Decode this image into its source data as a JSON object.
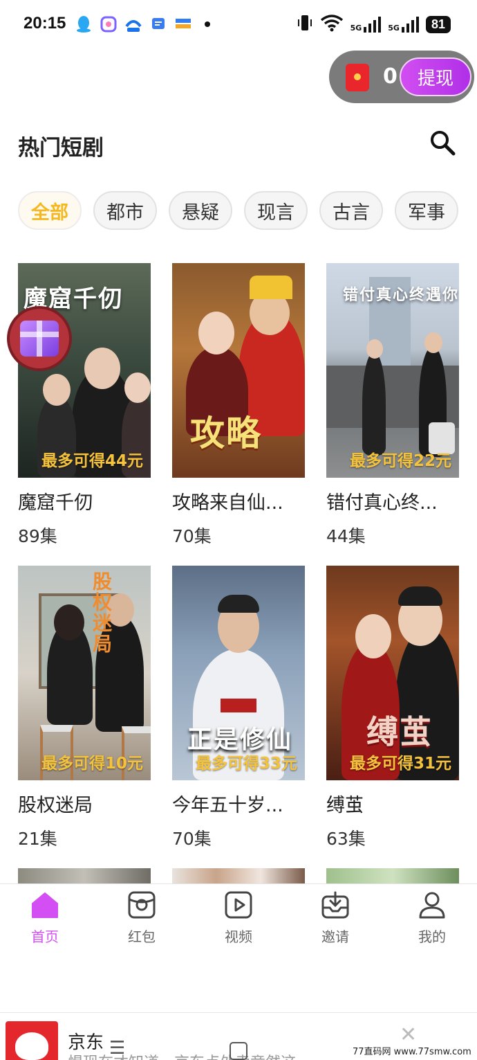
{
  "status_bar": {
    "time": "20:15",
    "battery": "81",
    "signal_label": "5G",
    "icons": [
      "qq-icon",
      "app-icon",
      "fly-app-icon",
      "message-icon",
      "wallet-icon",
      "vibrate-icon",
      "wifi-icon",
      "signal-icon",
      "signal-icon"
    ]
  },
  "reward": {
    "count": "0",
    "withdraw_label": "提现"
  },
  "header": {
    "title": "热门短剧"
  },
  "categories": [
    "全部",
    "都市",
    "悬疑",
    "现言",
    "古言",
    "军事"
  ],
  "active_category": "全部",
  "dramas": [
    {
      "title": "魔窟千仞",
      "episodes": "89集",
      "poster_caption": "魔窟千仞",
      "reward_tag": "最多可得44元"
    },
    {
      "title": "攻略来自仙...",
      "episodes": "70集",
      "poster_caption": "攻略",
      "reward_tag": ""
    },
    {
      "title": "错付真心终...",
      "episodes": "44集",
      "poster_caption": "错付真心终遇你",
      "reward_tag": "最多可得22元"
    },
    {
      "title": "股权迷局",
      "episodes": "21集",
      "poster_caption": "股权迷局",
      "reward_tag": "最多可得10元"
    },
    {
      "title": "今年五十岁...",
      "episodes": "70集",
      "poster_caption": "正是修仙",
      "reward_tag": "最多可得33元"
    },
    {
      "title": "缚茧",
      "episodes": "63集",
      "poster_caption": "缚茧",
      "reward_tag": "最多可得31元"
    }
  ],
  "nav": [
    {
      "label": "首页",
      "icon": "home-icon",
      "active": true
    },
    {
      "label": "红包",
      "icon": "red-packet-icon",
      "active": false
    },
    {
      "label": "视频",
      "icon": "video-icon",
      "active": false
    },
    {
      "label": "邀请",
      "icon": "invite-icon",
      "active": false
    },
    {
      "label": "我的",
      "icon": "profile-icon",
      "active": false
    }
  ],
  "ad": {
    "name": "京东",
    "description": "惧现在才知道，京东点外卖竟然这",
    "close": "✕"
  },
  "watermark": "77直码网 www.77smw.com",
  "colors": {
    "accent": "#d44ff3",
    "chip_active": "#f5b821",
    "reward_gold": "#f5c33b"
  }
}
